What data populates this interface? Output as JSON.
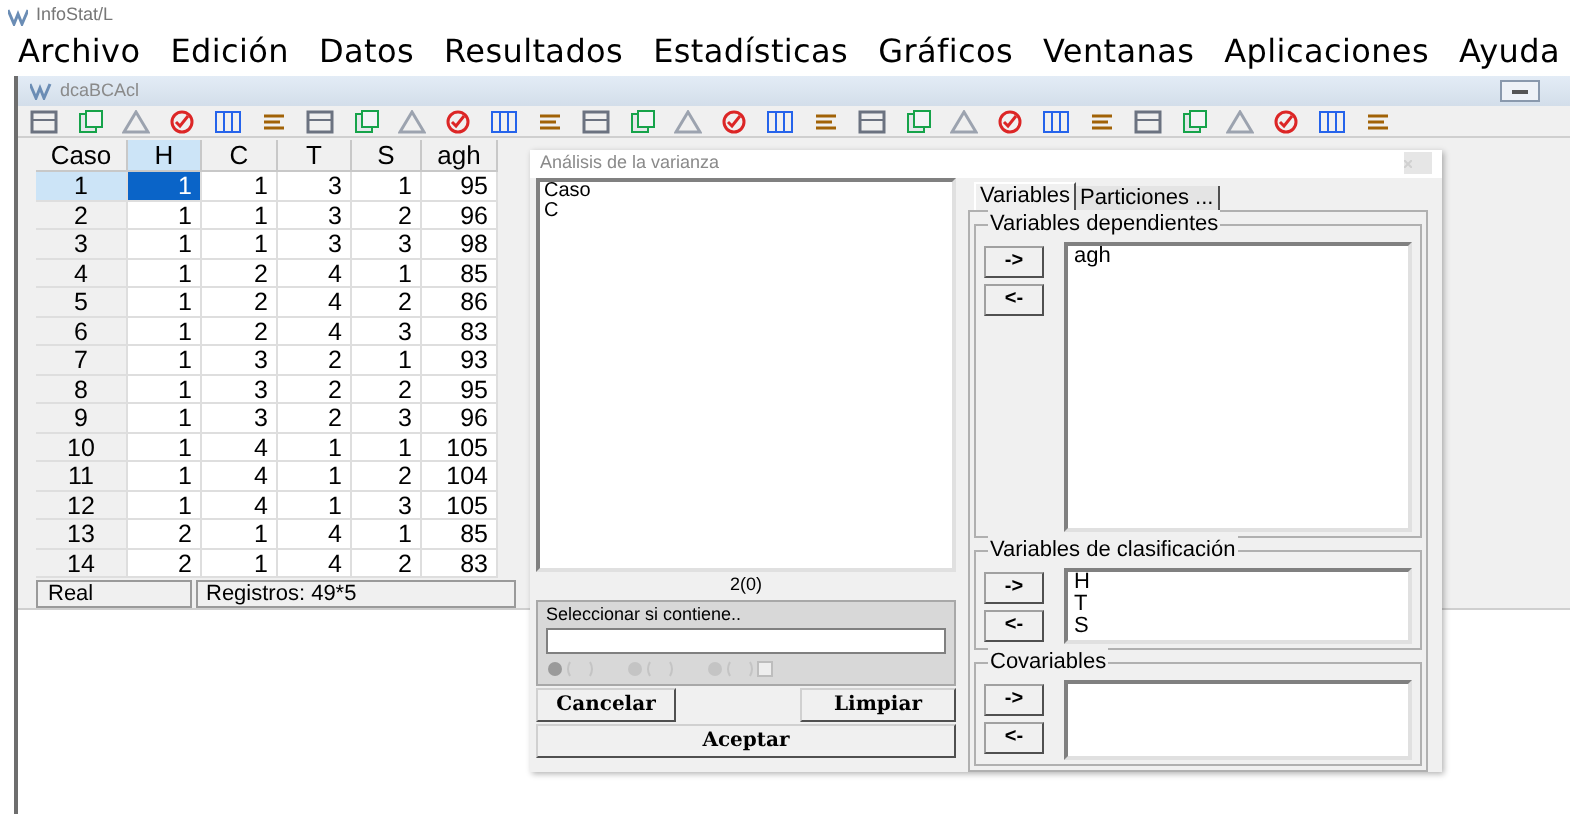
{
  "app_title": "InfoStat/L",
  "menu": [
    "Archivo",
    "Edición",
    "Datos",
    "Resultados",
    "Estadísticas",
    "Gráficos",
    "Ventanas",
    "Aplicaciones",
    "Ayuda"
  ],
  "child_window": {
    "title": "dcaBCAcl"
  },
  "table": {
    "columns": [
      {
        "label": "Caso",
        "selected": false
      },
      {
        "label": "H",
        "selected": true
      },
      {
        "label": "C",
        "selected": false
      },
      {
        "label": "T",
        "selected": false
      },
      {
        "label": "S",
        "selected": false
      },
      {
        "label": "agh",
        "selected": false
      }
    ],
    "rows": [
      {
        "cells": [
          "1",
          "1",
          "1",
          "3",
          "1",
          "95"
        ],
        "selected": true
      },
      {
        "cells": [
          "2",
          "1",
          "1",
          "3",
          "2",
          "96"
        ],
        "selected": false
      },
      {
        "cells": [
          "3",
          "1",
          "1",
          "3",
          "3",
          "98"
        ],
        "selected": false
      },
      {
        "cells": [
          "4",
          "1",
          "2",
          "4",
          "1",
          "85"
        ],
        "selected": false
      },
      {
        "cells": [
          "5",
          "1",
          "2",
          "4",
          "2",
          "86"
        ],
        "selected": false
      },
      {
        "cells": [
          "6",
          "1",
          "2",
          "4",
          "3",
          "83"
        ],
        "selected": false
      },
      {
        "cells": [
          "7",
          "1",
          "3",
          "2",
          "1",
          "93"
        ],
        "selected": false
      },
      {
        "cells": [
          "8",
          "1",
          "3",
          "2",
          "2",
          "95"
        ],
        "selected": false
      },
      {
        "cells": [
          "9",
          "1",
          "3",
          "2",
          "3",
          "96"
        ],
        "selected": false
      },
      {
        "cells": [
          "10",
          "1",
          "4",
          "1",
          "1",
          "105"
        ],
        "selected": false
      },
      {
        "cells": [
          "11",
          "1",
          "4",
          "1",
          "2",
          "104"
        ],
        "selected": false
      },
      {
        "cells": [
          "12",
          "1",
          "4",
          "1",
          "3",
          "105"
        ],
        "selected": false
      },
      {
        "cells": [
          "13",
          "2",
          "1",
          "4",
          "1",
          "85"
        ],
        "selected": false
      },
      {
        "cells": [
          "14",
          "2",
          "1",
          "4",
          "2",
          "83"
        ],
        "selected": false
      }
    ]
  },
  "status_bar": [
    "Real",
    "Registros: 49*5"
  ],
  "dialog": {
    "title": "Análisis de la varianza",
    "variables": [
      "Caso",
      "C"
    ],
    "count": "2(0)",
    "filter": {
      "label": "Seleccionar si contiene.."
    },
    "buttons": [
      "Cancelar",
      "Limpiar",
      "Aceptar"
    ],
    "tabs": [
      {
        "label": "Variables",
        "selected": true
      },
      {
        "label": "Particiones ...",
        "selected": false
      }
    ],
    "groups": [
      {
        "title": "Variables dependientes",
        "items": [
          "agh"
        ],
        "kind": "dependent"
      },
      {
        "title": "Variables de clasificación",
        "items": [
          "H",
          "T",
          "S"
        ],
        "kind": "classification"
      },
      {
        "title": "Covariables",
        "kind": "covariate"
      }
    ],
    "move_buttons": [
      "->",
      "<-"
    ]
  }
}
